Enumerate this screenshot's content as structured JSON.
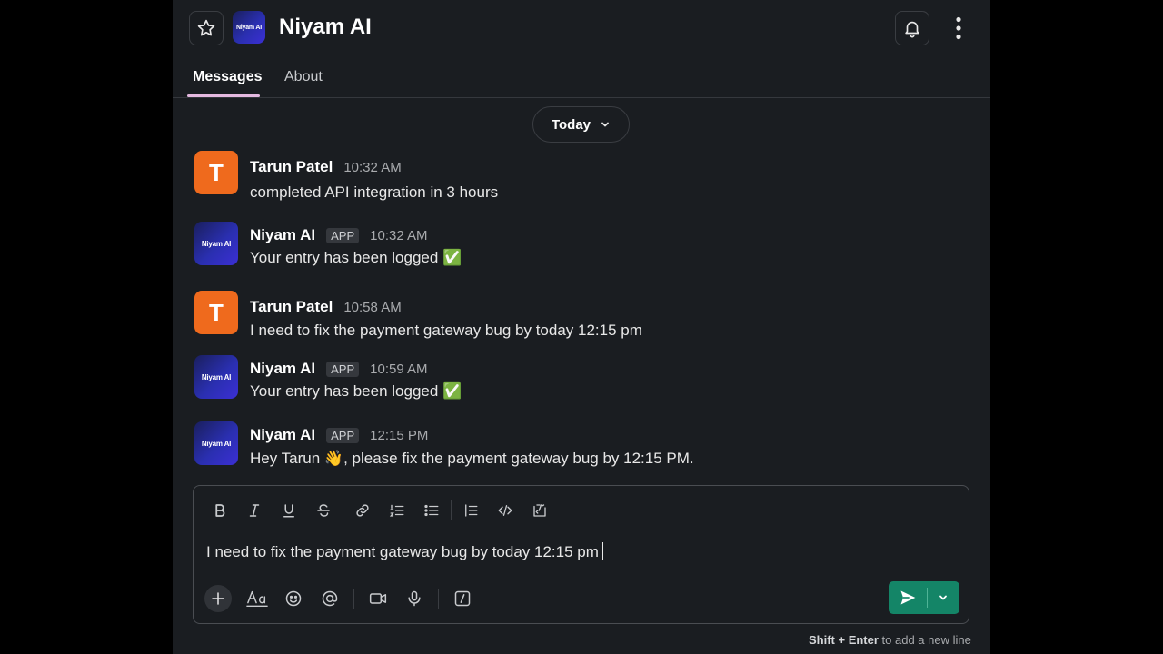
{
  "header": {
    "title": "Niyam AI",
    "logo_text": "Niyam AI"
  },
  "tabs": [
    {
      "label": "Messages",
      "active": true
    },
    {
      "label": "About",
      "active": false
    }
  ],
  "date_divider": {
    "label": "Today"
  },
  "messages": [
    {
      "author": "Tarun Patel",
      "avatar": "T",
      "badge": "",
      "time": "10:32 AM",
      "text": "completed API integration in 3 hours"
    },
    {
      "author": "Niyam AI",
      "avatar": "Niyam AI",
      "badge": "APP",
      "time": "10:32 AM",
      "text": "Your entry has been logged ✅"
    },
    {
      "author": "Tarun Patel",
      "avatar": "T",
      "badge": "",
      "time": "10:58 AM",
      "text": "I need to fix the payment gateway bug by today 12:15 pm"
    },
    {
      "author": "Niyam AI",
      "avatar": "Niyam AI",
      "badge": "APP",
      "time": "10:59 AM",
      "text": "Your entry has been logged ✅"
    },
    {
      "author": "Niyam AI",
      "avatar": "Niyam AI",
      "badge": "APP",
      "time": "12:15 PM",
      "text": "Hey Tarun 👋, please fix the payment gateway bug by 12:15 PM."
    }
  ],
  "composer": {
    "value": "I need to fix the payment gateway bug by today 12:15 pm",
    "hint_keys": "Shift + Enter",
    "hint_text": " to add a new line"
  },
  "colors": {
    "background": "#1a1d21",
    "send_button": "#148567",
    "tarun_avatar": "#ef6a1d",
    "tab_underline": "#e4b9e0"
  },
  "icons": {
    "header": [
      "star-icon",
      "bell-icon",
      "more-vertical-icon",
      "chevron-down-icon"
    ],
    "formatting": [
      "bold-icon",
      "italic-icon",
      "underline-icon",
      "strikethrough-icon",
      "link-icon",
      "ordered-list-icon",
      "bulleted-list-icon",
      "blockquote-icon",
      "code-icon",
      "code-block-icon"
    ],
    "actions": [
      "plus-icon",
      "text-format-icon",
      "emoji-icon",
      "mention-icon",
      "video-icon",
      "microphone-icon",
      "slash-command-icon",
      "send-icon"
    ]
  }
}
